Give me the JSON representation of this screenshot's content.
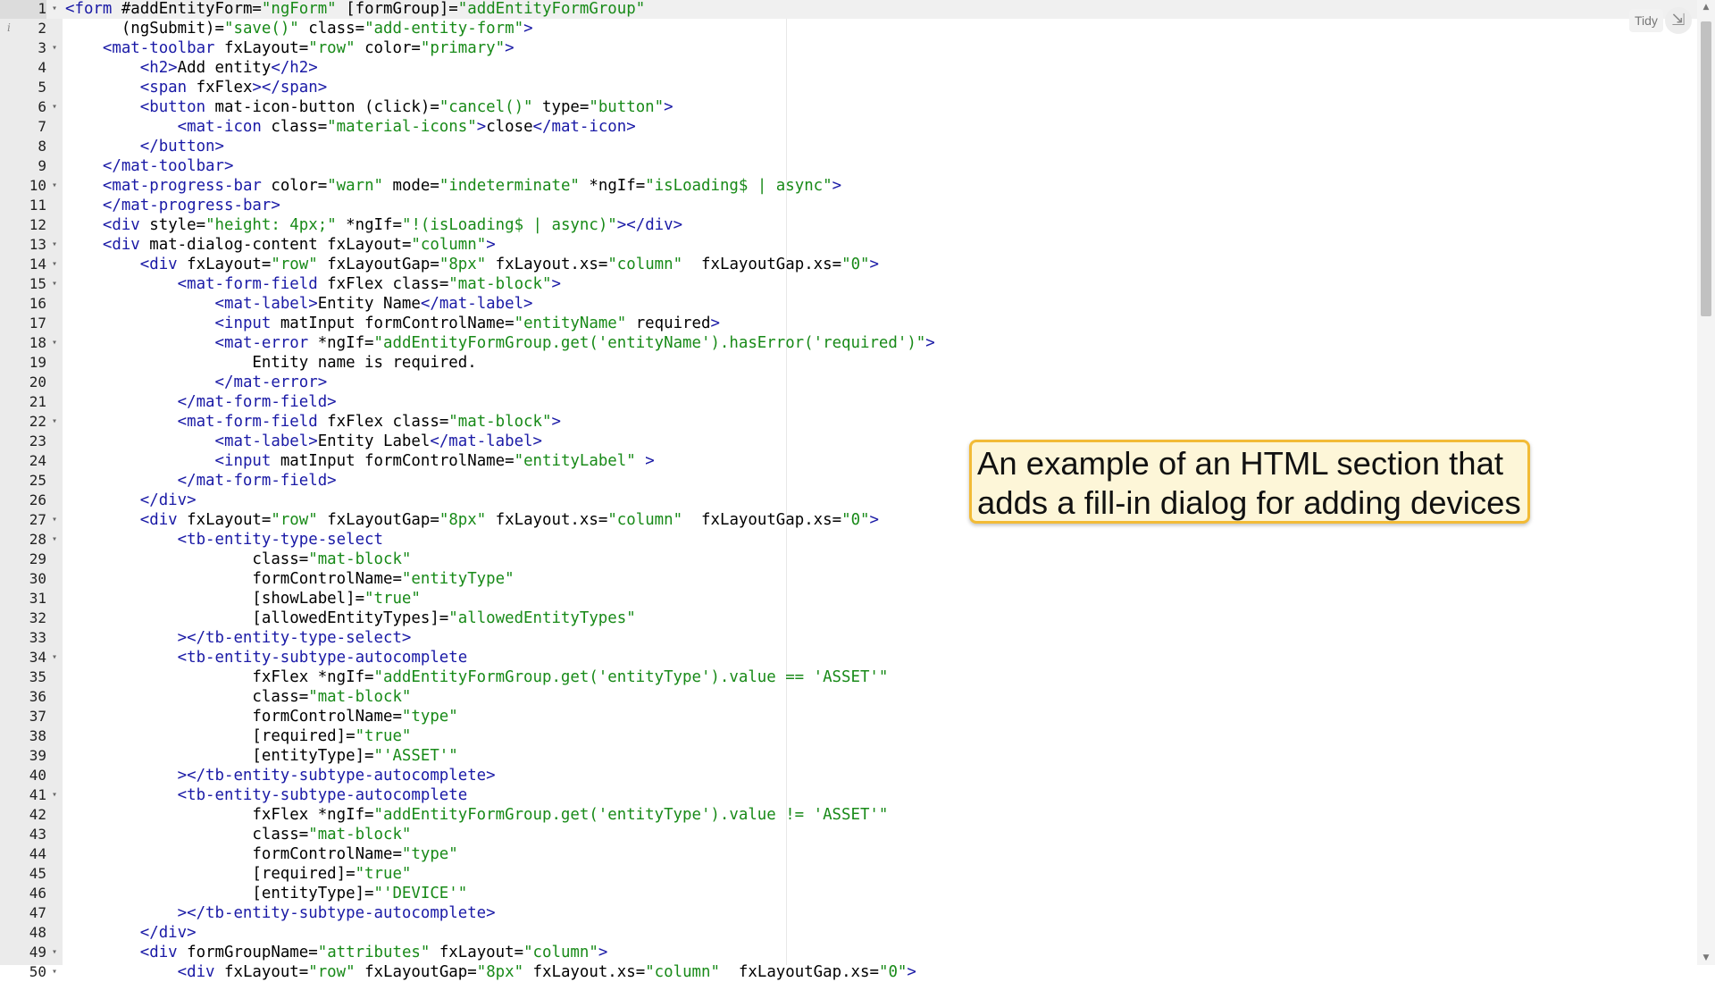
{
  "editor": {
    "active_line": 1,
    "toolbar": {
      "tidy_label": "Tidy",
      "collapse_icon": "collapse-icon"
    },
    "lines": [
      {
        "n": "1",
        "fold": true,
        "tokens": [
          [
            "tag",
            "<form"
          ],
          [
            "txt",
            " #addEntityForm="
          ],
          [
            "str",
            "\"ngForm\""
          ],
          [
            "txt",
            " [formGroup]="
          ],
          [
            "str",
            "\"addEntityFormGroup\""
          ]
        ]
      },
      {
        "n": "2",
        "fold": false,
        "tokens": [
          [
            "txt",
            "      (ngSubmit)="
          ],
          [
            "str",
            "\"save()\""
          ],
          [
            "txt",
            " class="
          ],
          [
            "str",
            "\"add-entity-form\""
          ],
          [
            "tag",
            ">"
          ]
        ]
      },
      {
        "n": "3",
        "fold": true,
        "tokens": [
          [
            "txt",
            "    "
          ],
          [
            "tag",
            "<mat-toolbar"
          ],
          [
            "txt",
            " fxLayout="
          ],
          [
            "str",
            "\"row\""
          ],
          [
            "txt",
            " color="
          ],
          [
            "str",
            "\"primary\""
          ],
          [
            "tag",
            ">"
          ]
        ]
      },
      {
        "n": "4",
        "fold": false,
        "tokens": [
          [
            "txt",
            "        "
          ],
          [
            "tag",
            "<h2>"
          ],
          [
            "txt",
            "Add entity"
          ],
          [
            "tag",
            "</h2>"
          ]
        ]
      },
      {
        "n": "5",
        "fold": false,
        "tokens": [
          [
            "txt",
            "        "
          ],
          [
            "tag",
            "<span"
          ],
          [
            "txt",
            " fxFlex"
          ],
          [
            "tag",
            "></span>"
          ]
        ]
      },
      {
        "n": "6",
        "fold": true,
        "tokens": [
          [
            "txt",
            "        "
          ],
          [
            "tag",
            "<button"
          ],
          [
            "txt",
            " mat-icon-button (click)="
          ],
          [
            "str",
            "\"cancel()\""
          ],
          [
            "txt",
            " type="
          ],
          [
            "str",
            "\"button\""
          ],
          [
            "tag",
            ">"
          ]
        ]
      },
      {
        "n": "7",
        "fold": false,
        "tokens": [
          [
            "txt",
            "            "
          ],
          [
            "tag",
            "<mat-icon"
          ],
          [
            "txt",
            " class="
          ],
          [
            "str",
            "\"material-icons\""
          ],
          [
            "tag",
            ">"
          ],
          [
            "txt",
            "close"
          ],
          [
            "tag",
            "</mat-icon>"
          ]
        ]
      },
      {
        "n": "8",
        "fold": false,
        "tokens": [
          [
            "txt",
            "        "
          ],
          [
            "tag",
            "</button>"
          ]
        ]
      },
      {
        "n": "9",
        "fold": false,
        "tokens": [
          [
            "txt",
            "    "
          ],
          [
            "tag",
            "</mat-toolbar>"
          ]
        ]
      },
      {
        "n": "10",
        "fold": true,
        "tokens": [
          [
            "txt",
            "    "
          ],
          [
            "tag",
            "<mat-progress-bar"
          ],
          [
            "txt",
            " color="
          ],
          [
            "str",
            "\"warn\""
          ],
          [
            "txt",
            " mode="
          ],
          [
            "str",
            "\"indeterminate\""
          ],
          [
            "txt",
            " *ngIf="
          ],
          [
            "str",
            "\"isLoading$ | async\""
          ],
          [
            "tag",
            ">"
          ]
        ]
      },
      {
        "n": "11",
        "fold": false,
        "tokens": [
          [
            "txt",
            "    "
          ],
          [
            "tag",
            "</mat-progress-bar>"
          ]
        ]
      },
      {
        "n": "12",
        "fold": false,
        "tokens": [
          [
            "txt",
            "    "
          ],
          [
            "tag",
            "<div"
          ],
          [
            "txt",
            " style="
          ],
          [
            "str",
            "\"height: 4px;\""
          ],
          [
            "txt",
            " *ngIf="
          ],
          [
            "str",
            "\"!(isLoading$ | async)\""
          ],
          [
            "tag",
            "></div>"
          ]
        ]
      },
      {
        "n": "13",
        "fold": true,
        "tokens": [
          [
            "txt",
            "    "
          ],
          [
            "tag",
            "<div"
          ],
          [
            "txt",
            " mat-dialog-content fxLayout="
          ],
          [
            "str",
            "\"column\""
          ],
          [
            "tag",
            ">"
          ]
        ]
      },
      {
        "n": "14",
        "fold": true,
        "tokens": [
          [
            "txt",
            "        "
          ],
          [
            "tag",
            "<div"
          ],
          [
            "txt",
            " fxLayout="
          ],
          [
            "str",
            "\"row\""
          ],
          [
            "txt",
            " fxLayoutGap="
          ],
          [
            "str",
            "\"8px\""
          ],
          [
            "txt",
            " fxLayout.xs="
          ],
          [
            "str",
            "\"column\""
          ],
          [
            "txt",
            "  fxLayoutGap.xs="
          ],
          [
            "str",
            "\"0\""
          ],
          [
            "tag",
            ">"
          ]
        ]
      },
      {
        "n": "15",
        "fold": true,
        "tokens": [
          [
            "txt",
            "            "
          ],
          [
            "tag",
            "<mat-form-field"
          ],
          [
            "txt",
            " fxFlex class="
          ],
          [
            "str",
            "\"mat-block\""
          ],
          [
            "tag",
            ">"
          ]
        ]
      },
      {
        "n": "16",
        "fold": false,
        "tokens": [
          [
            "txt",
            "                "
          ],
          [
            "tag",
            "<mat-label>"
          ],
          [
            "txt",
            "Entity Name"
          ],
          [
            "tag",
            "</mat-label>"
          ]
        ]
      },
      {
        "n": "17",
        "fold": false,
        "tokens": [
          [
            "txt",
            "                "
          ],
          [
            "tag",
            "<input"
          ],
          [
            "txt",
            " matInput formControlName="
          ],
          [
            "str",
            "\"entityName\""
          ],
          [
            "txt",
            " required"
          ],
          [
            "tag",
            ">"
          ]
        ]
      },
      {
        "n": "18",
        "fold": true,
        "tokens": [
          [
            "txt",
            "                "
          ],
          [
            "tag",
            "<mat-error"
          ],
          [
            "txt",
            " *ngIf="
          ],
          [
            "str",
            "\"addEntityFormGroup.get('entityName').hasError('required')\""
          ],
          [
            "tag",
            ">"
          ]
        ]
      },
      {
        "n": "19",
        "fold": false,
        "tokens": [
          [
            "txt",
            "                    Entity name is required."
          ]
        ]
      },
      {
        "n": "20",
        "fold": false,
        "tokens": [
          [
            "txt",
            "                "
          ],
          [
            "tag",
            "</mat-error>"
          ]
        ]
      },
      {
        "n": "21",
        "fold": false,
        "tokens": [
          [
            "txt",
            "            "
          ],
          [
            "tag",
            "</mat-form-field>"
          ]
        ]
      },
      {
        "n": "22",
        "fold": true,
        "tokens": [
          [
            "txt",
            "            "
          ],
          [
            "tag",
            "<mat-form-field"
          ],
          [
            "txt",
            " fxFlex class="
          ],
          [
            "str",
            "\"mat-block\""
          ],
          [
            "tag",
            ">"
          ]
        ]
      },
      {
        "n": "23",
        "fold": false,
        "tokens": [
          [
            "txt",
            "                "
          ],
          [
            "tag",
            "<mat-label>"
          ],
          [
            "txt",
            "Entity Label"
          ],
          [
            "tag",
            "</mat-label>"
          ]
        ]
      },
      {
        "n": "24",
        "fold": false,
        "tokens": [
          [
            "txt",
            "                "
          ],
          [
            "tag",
            "<input"
          ],
          [
            "txt",
            " matInput formControlName="
          ],
          [
            "str",
            "\"entityLabel\""
          ],
          [
            "txt",
            " "
          ],
          [
            "tag",
            ">"
          ]
        ]
      },
      {
        "n": "25",
        "fold": false,
        "tokens": [
          [
            "txt",
            "            "
          ],
          [
            "tag",
            "</mat-form-field>"
          ]
        ]
      },
      {
        "n": "26",
        "fold": false,
        "tokens": [
          [
            "txt",
            "        "
          ],
          [
            "tag",
            "</div>"
          ]
        ]
      },
      {
        "n": "27",
        "fold": true,
        "tokens": [
          [
            "txt",
            "        "
          ],
          [
            "tag",
            "<div"
          ],
          [
            "txt",
            " fxLayout="
          ],
          [
            "str",
            "\"row\""
          ],
          [
            "txt",
            " fxLayoutGap="
          ],
          [
            "str",
            "\"8px\""
          ],
          [
            "txt",
            " fxLayout.xs="
          ],
          [
            "str",
            "\"column\""
          ],
          [
            "txt",
            "  fxLayoutGap.xs="
          ],
          [
            "str",
            "\"0\""
          ],
          [
            "tag",
            ">"
          ]
        ]
      },
      {
        "n": "28",
        "fold": true,
        "tokens": [
          [
            "txt",
            "            "
          ],
          [
            "tag",
            "<tb-entity-type-select"
          ]
        ]
      },
      {
        "n": "29",
        "fold": false,
        "tokens": [
          [
            "txt",
            "                    class="
          ],
          [
            "str",
            "\"mat-block\""
          ]
        ]
      },
      {
        "n": "30",
        "fold": false,
        "tokens": [
          [
            "txt",
            "                    formControlName="
          ],
          [
            "str",
            "\"entityType\""
          ]
        ]
      },
      {
        "n": "31",
        "fold": false,
        "tokens": [
          [
            "txt",
            "                    [showLabel]="
          ],
          [
            "str",
            "\"true\""
          ]
        ]
      },
      {
        "n": "32",
        "fold": false,
        "tokens": [
          [
            "txt",
            "                    [allowedEntityTypes]="
          ],
          [
            "str",
            "\"allowedEntityTypes\""
          ]
        ]
      },
      {
        "n": "33",
        "fold": false,
        "tokens": [
          [
            "txt",
            "            "
          ],
          [
            "tag",
            "></tb-entity-type-select>"
          ]
        ]
      },
      {
        "n": "34",
        "fold": true,
        "tokens": [
          [
            "txt",
            "            "
          ],
          [
            "tag",
            "<tb-entity-subtype-autocomplete"
          ]
        ]
      },
      {
        "n": "35",
        "fold": false,
        "tokens": [
          [
            "txt",
            "                    fxFlex *ngIf="
          ],
          [
            "str",
            "\"addEntityFormGroup.get('entityType').value == 'ASSET'\""
          ]
        ]
      },
      {
        "n": "36",
        "fold": false,
        "tokens": [
          [
            "txt",
            "                    class="
          ],
          [
            "str",
            "\"mat-block\""
          ]
        ]
      },
      {
        "n": "37",
        "fold": false,
        "tokens": [
          [
            "txt",
            "                    formControlName="
          ],
          [
            "str",
            "\"type\""
          ]
        ]
      },
      {
        "n": "38",
        "fold": false,
        "tokens": [
          [
            "txt",
            "                    [required]="
          ],
          [
            "str",
            "\"true\""
          ]
        ]
      },
      {
        "n": "39",
        "fold": false,
        "tokens": [
          [
            "txt",
            "                    [entityType]="
          ],
          [
            "str",
            "\"'ASSET'\""
          ]
        ]
      },
      {
        "n": "40",
        "fold": false,
        "tokens": [
          [
            "txt",
            "            "
          ],
          [
            "tag",
            "></tb-entity-subtype-autocomplete>"
          ]
        ]
      },
      {
        "n": "41",
        "fold": true,
        "tokens": [
          [
            "txt",
            "            "
          ],
          [
            "tag",
            "<tb-entity-subtype-autocomplete"
          ]
        ]
      },
      {
        "n": "42",
        "fold": false,
        "tokens": [
          [
            "txt",
            "                    fxFlex *ngIf="
          ],
          [
            "str",
            "\"addEntityFormGroup.get('entityType').value != 'ASSET'\""
          ]
        ]
      },
      {
        "n": "43",
        "fold": false,
        "tokens": [
          [
            "txt",
            "                    class="
          ],
          [
            "str",
            "\"mat-block\""
          ]
        ]
      },
      {
        "n": "44",
        "fold": false,
        "tokens": [
          [
            "txt",
            "                    formControlName="
          ],
          [
            "str",
            "\"type\""
          ]
        ]
      },
      {
        "n": "45",
        "fold": false,
        "tokens": [
          [
            "txt",
            "                    [required]="
          ],
          [
            "str",
            "\"true\""
          ]
        ]
      },
      {
        "n": "46",
        "fold": false,
        "tokens": [
          [
            "txt",
            "                    [entityType]="
          ],
          [
            "str",
            "\"'DEVICE'\""
          ]
        ]
      },
      {
        "n": "47",
        "fold": false,
        "tokens": [
          [
            "txt",
            "            "
          ],
          [
            "tag",
            "></tb-entity-subtype-autocomplete>"
          ]
        ]
      },
      {
        "n": "48",
        "fold": false,
        "tokens": [
          [
            "txt",
            "        "
          ],
          [
            "tag",
            "</div>"
          ]
        ]
      },
      {
        "n": "49",
        "fold": true,
        "tokens": [
          [
            "txt",
            "        "
          ],
          [
            "tag",
            "<div"
          ],
          [
            "txt",
            " formGroupName="
          ],
          [
            "str",
            "\"attributes\""
          ],
          [
            "txt",
            " fxLayout="
          ],
          [
            "str",
            "\"column\""
          ],
          [
            "tag",
            ">"
          ]
        ]
      },
      {
        "n": "50",
        "fold": true,
        "tokens": [
          [
            "txt",
            "            "
          ],
          [
            "tag",
            "<div"
          ],
          [
            "txt",
            " fxLayout="
          ],
          [
            "str",
            "\"row\""
          ],
          [
            "txt",
            " fxLayoutGap="
          ],
          [
            "str",
            "\"8px\""
          ],
          [
            "txt",
            " fxLayout.xs="
          ],
          [
            "str",
            "\"column\""
          ],
          [
            "txt",
            "  fxLayoutGap.xs="
          ],
          [
            "str",
            "\"0\""
          ],
          [
            "tag",
            ">"
          ]
        ]
      }
    ]
  },
  "annotation": {
    "line1": "An example of an HTML section that",
    "line2": "adds a fill-in dialog for adding devices"
  },
  "colors": {
    "tag": "#1a1aa6",
    "string": "#188a18",
    "text": "#000000",
    "gutter": "#ebebeb",
    "callout_border": "#f2bb36",
    "callout_fill": "#fdf6d8"
  }
}
